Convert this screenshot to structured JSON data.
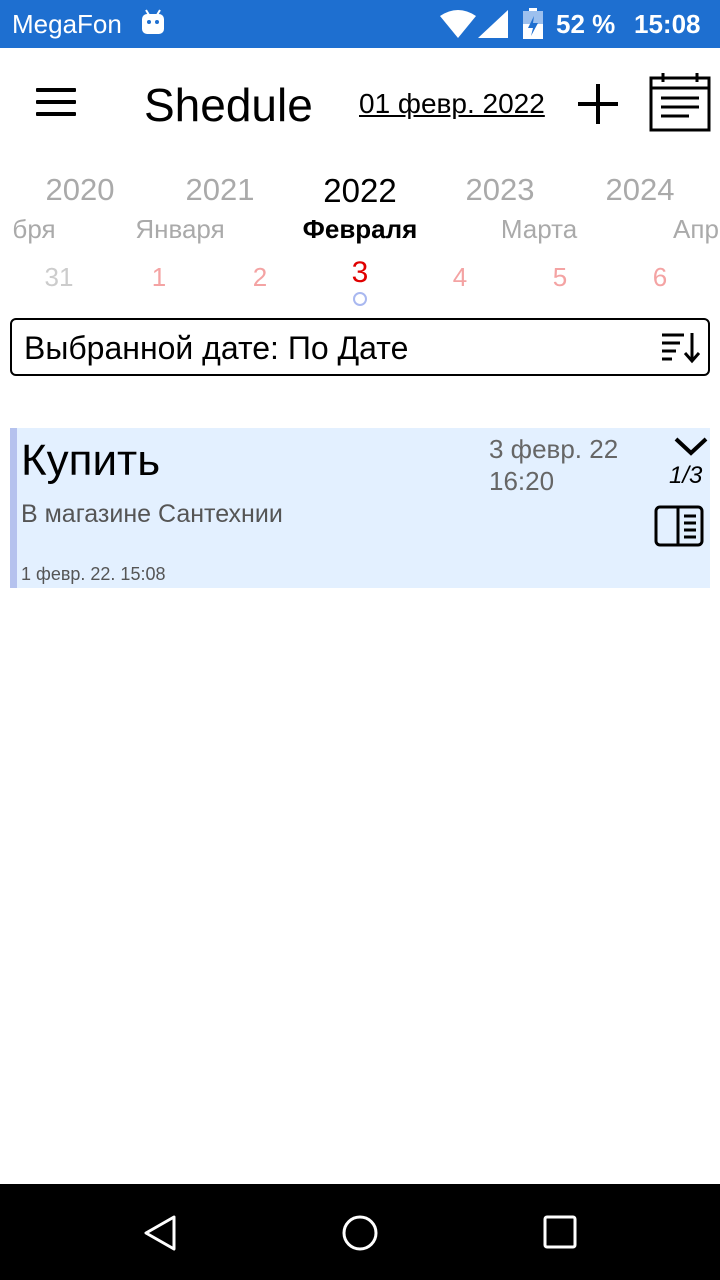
{
  "status_bar": {
    "carrier": "MegaFon",
    "battery_percent": "52 %",
    "time": "15:08",
    "color": "#1e6fd0"
  },
  "app_bar": {
    "title": "Shedule",
    "current_date": "01 февр. 2022",
    "icons": [
      "menu-icon",
      "add-icon",
      "calendar-icon"
    ]
  },
  "date_picker": {
    "years": [
      "2020",
      "2021",
      "2022",
      "2023",
      "2024"
    ],
    "selected_year": "2022",
    "months": [
      "бря",
      "Января",
      "Февраля",
      "Марта",
      "Апр"
    ],
    "selected_month": "Февраля",
    "days": [
      "31",
      "1",
      "2",
      "3",
      "4",
      "5",
      "6"
    ],
    "selected_day": "3",
    "selected_color": "#e00000"
  },
  "sort": {
    "label": "Выбранной дате: По Дате",
    "icon": "sort-icon"
  },
  "tasks": [
    {
      "title": "Купить",
      "description": "В магазине Сантехнии",
      "created": "1 февр. 22. 15:08",
      "due_date": "3 февр. 22",
      "due_time": "16:20",
      "counter": "1/3",
      "background": "#e3f0ff"
    }
  ],
  "nav_bar": {
    "icons": [
      "back-icon",
      "home-icon",
      "recents-icon"
    ]
  }
}
